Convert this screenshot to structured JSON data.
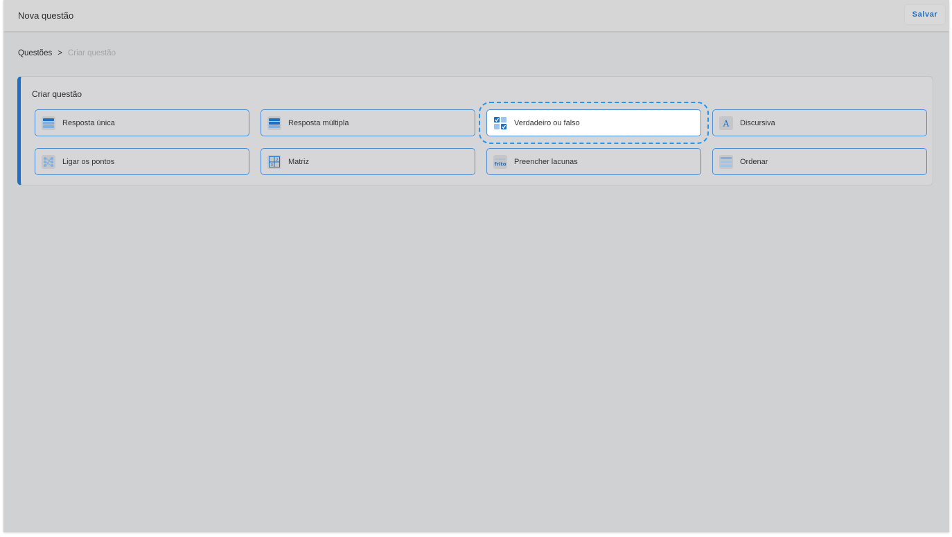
{
  "header": {
    "title": "Nova questão",
    "save_label": "Salvar"
  },
  "breadcrumb": {
    "items": [
      "Questões",
      "Criar questão"
    ],
    "separator": ">"
  },
  "create_card": {
    "title": "Criar questão",
    "accent_color": "#1d6fc4",
    "options": [
      {
        "label": "Resposta única",
        "icon": "single-answer-icon"
      },
      {
        "label": "Resposta múltipla",
        "icon": "multiple-answer-icon"
      },
      {
        "label": "Verdadeiro ou falso",
        "icon": "true-false-icon",
        "selected": true
      },
      {
        "label": "Discursiva",
        "icon": "text-a-icon"
      },
      {
        "label": "Ligar os pontos",
        "icon": "connect-dots-icon"
      },
      {
        "label": "Matriz",
        "icon": "matrix-icon"
      },
      {
        "label": "Preencher lacunas",
        "icon": "fill-blanks-icon",
        "icon_text": "frito"
      },
      {
        "label": "Ordenar",
        "icon": "order-list-icon"
      }
    ]
  }
}
